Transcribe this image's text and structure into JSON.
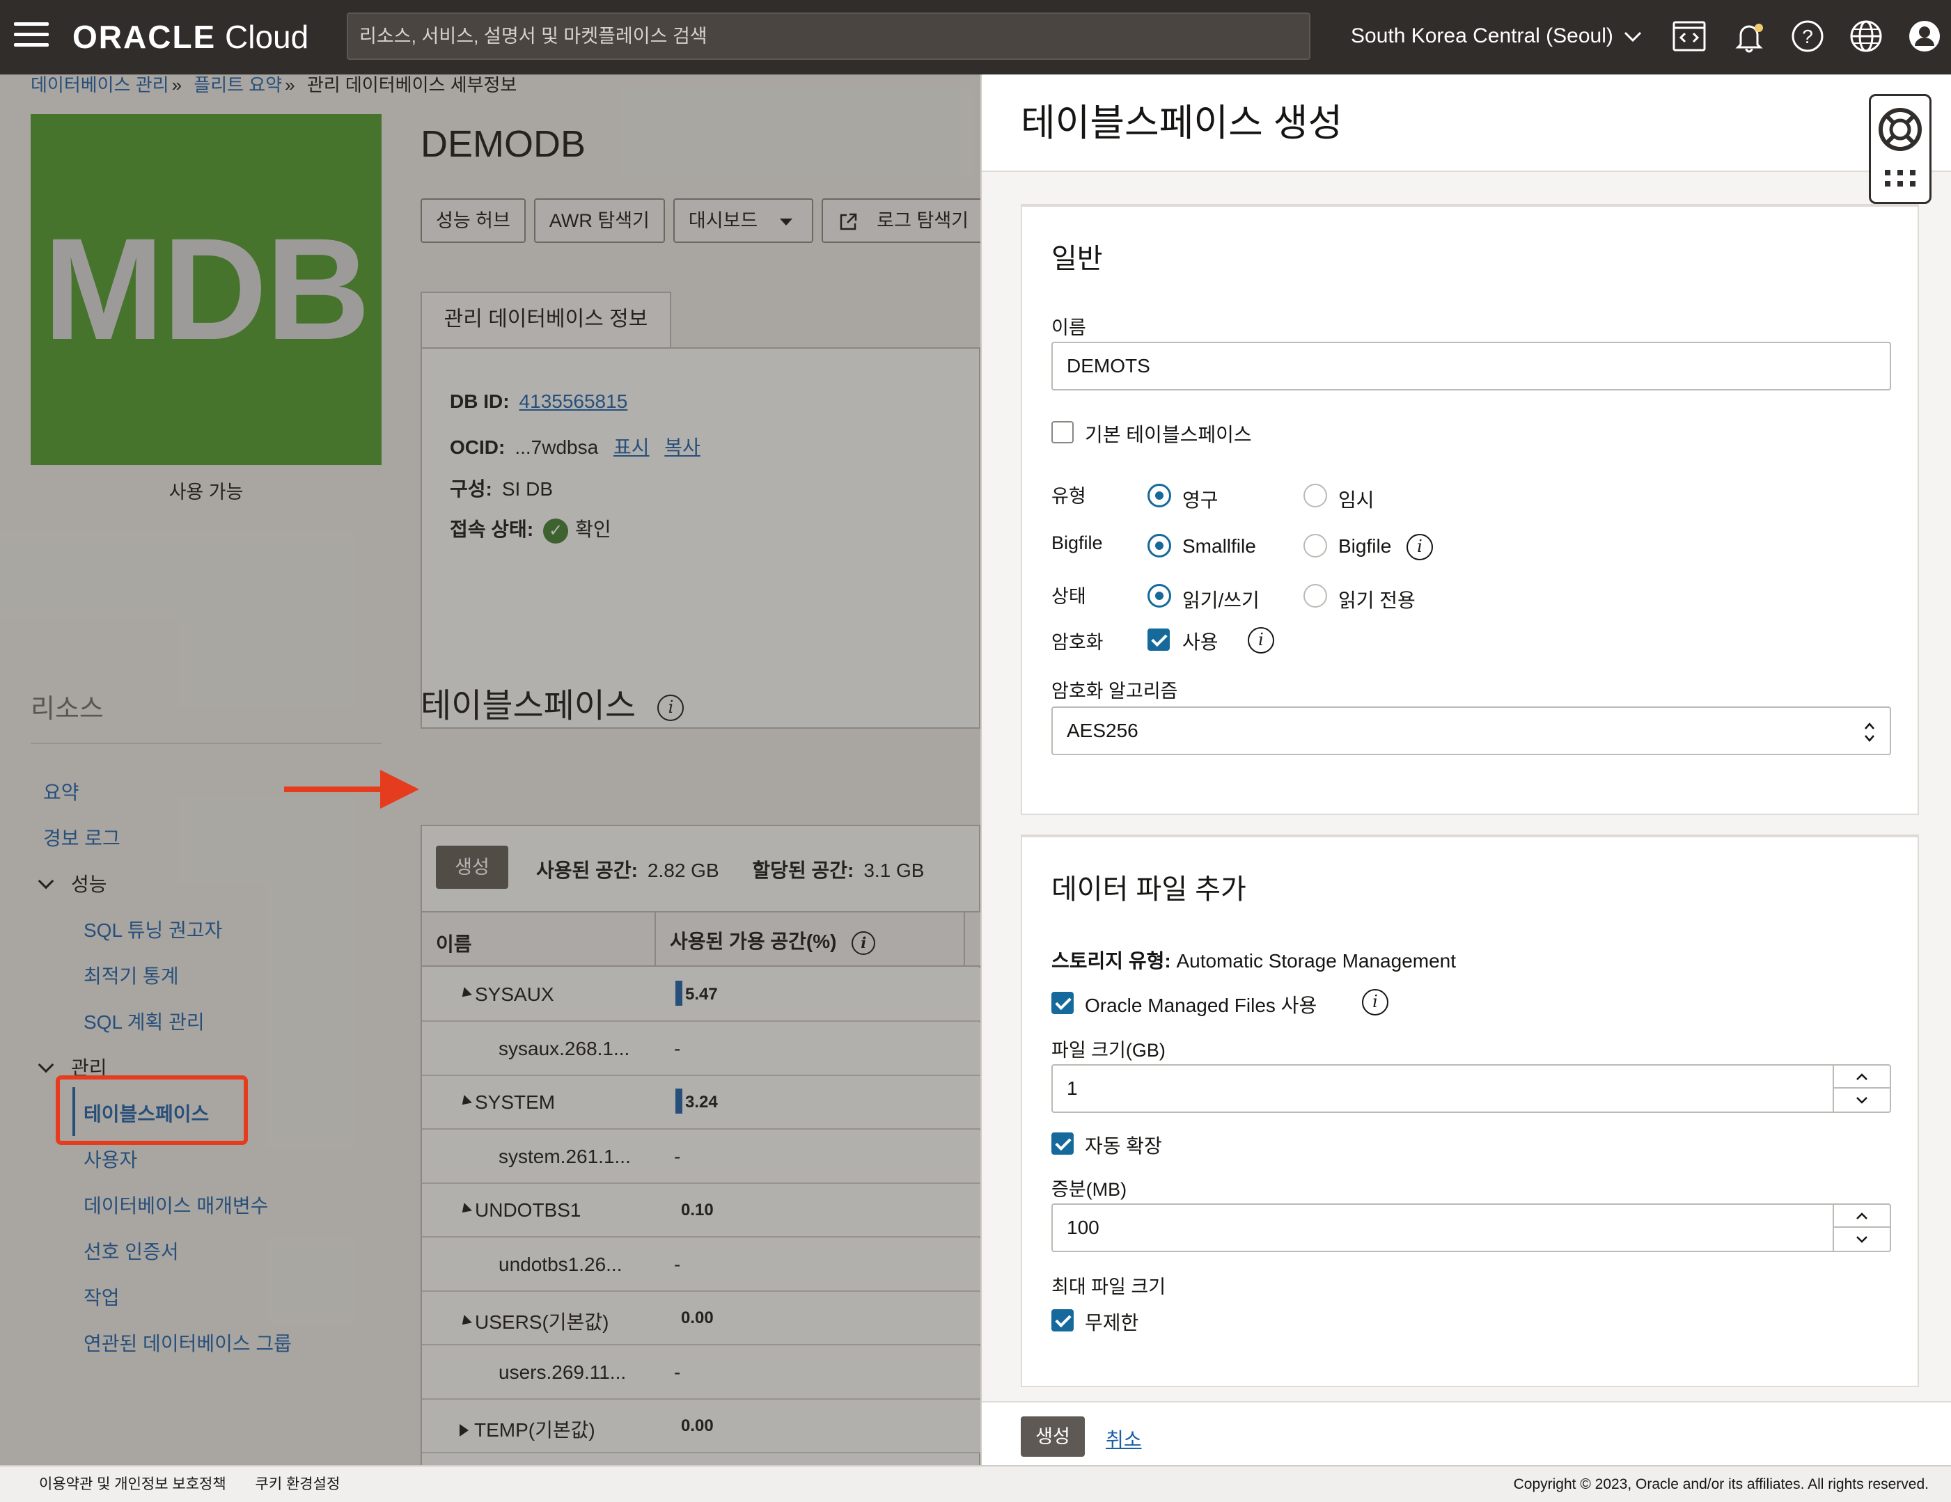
{
  "topbar": {
    "logo_bold": "ORACLE",
    "logo_light": "Cloud",
    "search_placeholder": "리소스, 서비스, 설명서 및 마켓플레이스 검색",
    "region": "South Korea Central (Seoul)",
    "icons": [
      "code-editor-icon",
      "bell-icon",
      "help-icon",
      "globe-icon",
      "user-avatar-icon"
    ]
  },
  "breadcrumb": {
    "items": [
      "데이터베이스 관리",
      "플리트 요약",
      "관리 데이터베이스 세부정보"
    ]
  },
  "db": {
    "badge_text": "MDB",
    "badge_color": "#4e9a2a",
    "status": "사용 가능",
    "name": "DEMODB",
    "buttons": [
      "성능 허브",
      "AWR 탐색기",
      "대시보드",
      "로그 탐색기"
    ],
    "info_tab": "관리 데이터베이스 정보",
    "info": {
      "db_id_label": "DB ID:",
      "db_id_value": "4135565815",
      "ocid_label": "OCID:",
      "ocid_value": "...7wdbsa",
      "ocid_show": "표시",
      "ocid_copy": "복사",
      "config_label": "구성:",
      "config_value": "SI DB",
      "conn_label": "접속 상태:",
      "conn_value": "확인"
    }
  },
  "resources": {
    "title": "리소스",
    "items": {
      "summary": "요약",
      "alert_log": "경보 로그",
      "performance": "성능",
      "sql_tuning": "SQL 튜닝 권고자",
      "optimizer_stats": "최적기 통계",
      "sql_plan": "SQL 계획 관리",
      "admin": "관리",
      "tablespaces": "테이블스페이스",
      "users": "사용자",
      "db_params": "데이터베이스 매개변수",
      "pref_creds": "선호 인증서",
      "jobs": "작업",
      "related_groups": "연관된 데이터베이스 그룹"
    }
  },
  "tablespaces": {
    "title": "테이블스페이스",
    "create_label": "생성",
    "used_label": "사용된 공간:",
    "used_value": "2.82 GB",
    "alloc_label": "할당된 공간:",
    "alloc_value": "3.1 GB",
    "col_name": "이름",
    "col_used": "사용된 가용 공간(%)",
    "rows": [
      {
        "name": "SYSAUX",
        "value": "5.47",
        "kind": "parent"
      },
      {
        "name": "sysaux.268.1...",
        "value": "-",
        "kind": "child"
      },
      {
        "name": "SYSTEM",
        "value": "3.24",
        "kind": "parent"
      },
      {
        "name": "system.261.1...",
        "value": "-",
        "kind": "child"
      },
      {
        "name": "UNDOTBS1",
        "value": "0.10",
        "kind": "parent"
      },
      {
        "name": "undotbs1.26...",
        "value": "-",
        "kind": "child"
      },
      {
        "name": "USERS(기본값)",
        "value": "0.00",
        "kind": "parent"
      },
      {
        "name": "users.269.11...",
        "value": "-",
        "kind": "child"
      },
      {
        "name": "TEMP(기본값)",
        "value": "0.00",
        "kind": "collapsed"
      }
    ]
  },
  "drawer": {
    "title": "테이블스페이스 생성",
    "general": {
      "title": "일반",
      "name_label": "이름",
      "name_value": "DEMOTS",
      "default_ts_label": "기본 테이블스페이스",
      "default_ts_checked": false,
      "type_label": "유형",
      "type_permanent": "영구",
      "type_temporary": "임시",
      "bigfile_label": "Bigfile",
      "smallfile": "Smallfile",
      "bigfile": "Bigfile",
      "status_label": "상태",
      "read_write": "읽기/쓰기",
      "read_only": "읽기 전용",
      "encryption_label": "암호화",
      "encryption_use": "사용",
      "encryption_checked": true,
      "algorithm_label": "암호화 알고리즘",
      "algorithm_value": "AES256"
    },
    "datafile": {
      "title": "데이터 파일 추가",
      "storage_label": "스토리지 유형:",
      "storage_value": "Automatic Storage Management",
      "omf_label": "Oracle Managed Files 사용",
      "omf_checked": true,
      "file_size_label": "파일 크기(GB)",
      "file_size_value": "1",
      "autoextend_label": "자동 확장",
      "autoextend_checked": true,
      "increment_label": "증분(MB)",
      "increment_value": "100",
      "max_size_label": "최대 파일 크기",
      "unlimited_label": "무제한",
      "unlimited_checked": true
    },
    "footer": {
      "create_label": "생성",
      "cancel_label": "취소"
    }
  },
  "page_footer": {
    "terms": "이용약관 및 개인정보 보호정책",
    "cookies": "쿠키 환경설정",
    "copyright": "Copyright © 2023, Oracle and/or its affiliates. All rights reserved."
  }
}
